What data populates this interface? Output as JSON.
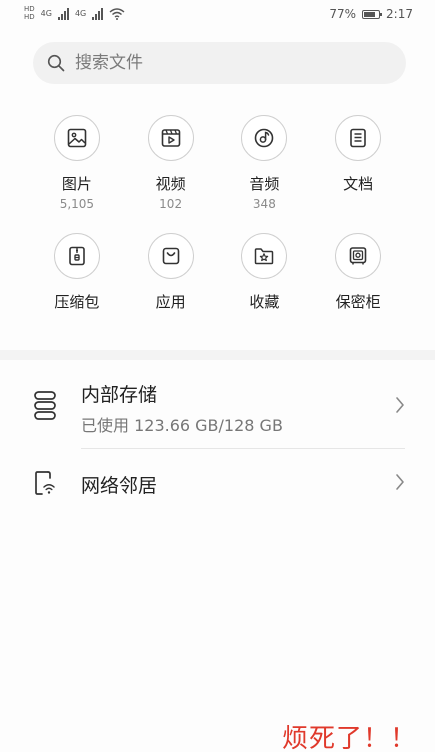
{
  "status_bar": {
    "sim1": "HD",
    "sim2": "HD",
    "net1": "4G",
    "net2": "4G",
    "battery": "77%",
    "time": "2:17",
    "battery_level": 0.77
  },
  "search": {
    "placeholder": "搜索文件",
    "icon": "search-icon"
  },
  "categories": [
    {
      "label": "图片",
      "count": "5,105",
      "icon": "image-icon"
    },
    {
      "label": "视频",
      "count": "102",
      "icon": "video-icon"
    },
    {
      "label": "音频",
      "count": "348",
      "icon": "audio-icon"
    },
    {
      "label": "文档",
      "count": "",
      "icon": "document-icon"
    },
    {
      "label": "压缩包",
      "count": "",
      "icon": "archive-icon"
    },
    {
      "label": "应用",
      "count": "",
      "icon": "app-bag-icon"
    },
    {
      "label": "收藏",
      "count": "",
      "icon": "favorite-folder-icon"
    },
    {
      "label": "保密柜",
      "count": "",
      "icon": "safe-icon"
    }
  ],
  "storage": {
    "title": "内部存储",
    "usage": "已使用 123.66 GB/128 GB",
    "icon": "storage-icon"
  },
  "network": {
    "title": "网络邻居",
    "icon": "network-neighbor-icon"
  },
  "annotation": "烦死了！！",
  "colors": {
    "accent_red": "#e0392b",
    "icon_gray": "#333333",
    "search_bg": "#f1f1f1"
  }
}
